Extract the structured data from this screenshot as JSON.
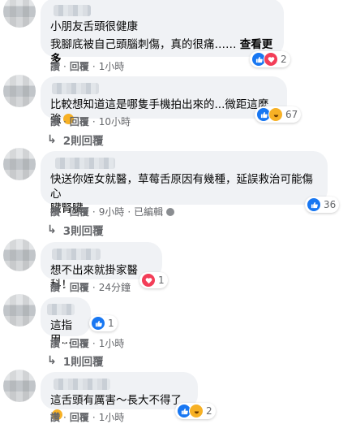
{
  "comments": [
    {
      "text": "小朋友舌頭很健康",
      "text2": "我腳底被自己頭腦刺傷，真的很痛……",
      "see_more": "查看更多",
      "reaction_count": "2",
      "actions": {
        "like": "讚",
        "reply": "回覆",
        "time": "1小時"
      }
    },
    {
      "text": "比較想知道這是哪隻手機拍出來的...微距這麼強",
      "reaction_count": "67",
      "actions": {
        "like": "讚",
        "reply": "回覆",
        "time": "10小時"
      },
      "replies": "2則回覆"
    },
    {
      "text": "快送你姪女就醫，草莓舌原因有幾種，延誤救治可能傷心",
      "text2": "臟腎臟。",
      "reaction_count": "36",
      "actions": {
        "like": "讚",
        "reply": "回覆",
        "time": "9小時",
        "edited": "已編輯"
      },
      "replies": "3則回覆"
    },
    {
      "text": "想不出來就掛家醫科！",
      "reaction_count": "1",
      "actions": {
        "like": "讚",
        "reply": "回覆",
        "time": "24分鐘"
      }
    },
    {
      "text": "這指甲...",
      "reaction_count": "1",
      "actions": {
        "like": "讚",
        "reply": "回覆",
        "time": "1小時"
      },
      "replies": "1則回覆"
    },
    {
      "text": "這舌頭有厲害～長大不得了",
      "reaction_count": "2",
      "actions": {
        "like": "讚",
        "reply": "回覆",
        "time": "1小時"
      }
    }
  ],
  "colors": {
    "like": "#1877f2",
    "love": "#f33e58",
    "haha": "#f7b125",
    "bubble": "#f0f2f5",
    "meta": "#65676b"
  }
}
